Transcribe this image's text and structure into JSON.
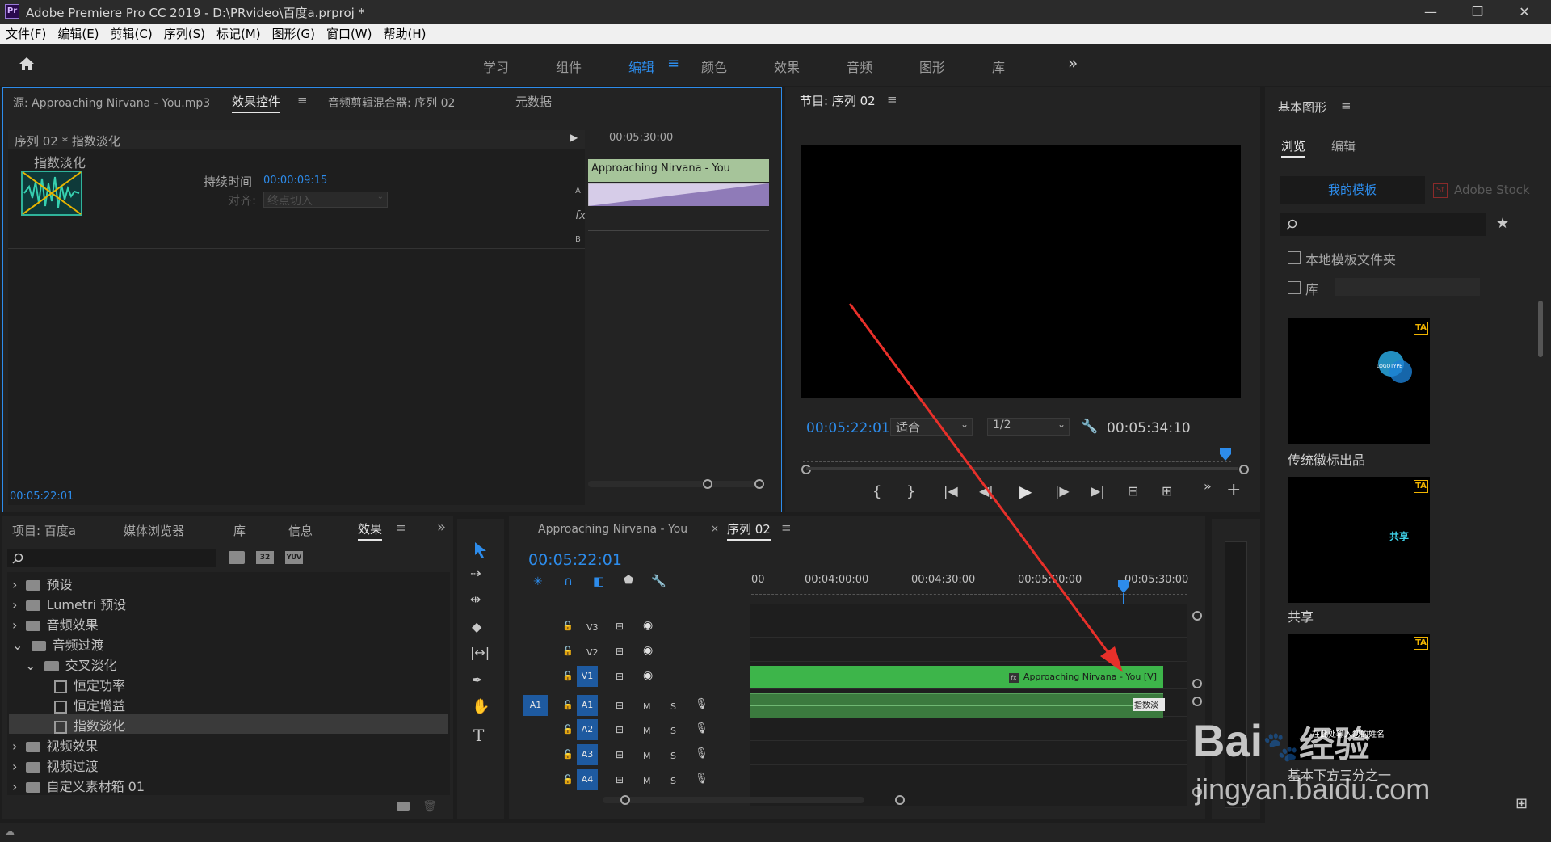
{
  "titlebar": {
    "logo": "Pr",
    "title": "Adobe Premiere Pro CC 2019 - D:\\PRvideo\\百度a.prproj *",
    "minimize": "—",
    "maximize": "❐",
    "close": "✕"
  },
  "menu": [
    "文件(F)",
    "编辑(E)",
    "剪辑(C)",
    "序列(S)",
    "标记(M)",
    "图形(G)",
    "窗口(W)",
    "帮助(H)"
  ],
  "workspaces": {
    "items": [
      "学习",
      "组件",
      "编辑",
      "颜色",
      "效果",
      "音频",
      "图形",
      "库"
    ],
    "active": "编辑",
    "more": "»"
  },
  "source_panel": {
    "tabs": [
      "源: Approaching Nirvana - You.mp3",
      "效果控件",
      "音频剪辑混合器: 序列 02",
      "元数据"
    ],
    "active_tab": "效果控件",
    "header": "序列 02 * 指数淡化",
    "effect_name": "指数淡化",
    "duration_label": "持续时间",
    "duration_value": "00:00:09:15",
    "align_label": "对齐:",
    "align_value": "终点切入",
    "timeline_time": "00:05:30:00",
    "clip_label": "Approaching Nirvana - You",
    "label_a": "A",
    "label_b": "B",
    "fx_label": "fx",
    "current_time": "00:05:22:01"
  },
  "program_monitor": {
    "title": "节目: 序列 02",
    "current_time": "00:05:22:01",
    "fit": "适合",
    "resolution": "1/2",
    "duration": "00:05:34:10"
  },
  "essential_graphics": {
    "title": "基本图形",
    "tabs": [
      "浏览",
      "编辑"
    ],
    "active_tab": "浏览",
    "subtabs": [
      "我的模板",
      "Adobe Stock"
    ],
    "active_subtab": "我的模板",
    "search_placeholder": "",
    "checkbox_local": "本地模板文件夹",
    "checkbox_lib": "库",
    "templates": [
      {
        "name": "传统徽标出品",
        "preview_text": "LOGOTYPE",
        "badge": "TA"
      },
      {
        "name": "共享",
        "preview_text": "共享",
        "badge": "TA"
      },
      {
        "name": "基本下方三分之一",
        "preview_text": "在此处输入您的姓名",
        "badge": "TA"
      }
    ]
  },
  "project_panel": {
    "tabs": [
      "项目: 百度a",
      "媒体浏览器",
      "库",
      "信息",
      "效果"
    ],
    "active_tab": "效果",
    "more": "»",
    "badges": [
      "32",
      "YUV"
    ],
    "tree": [
      {
        "label": "预设",
        "type": "folder",
        "level": 0
      },
      {
        "label": "Lumetri 预设",
        "type": "folder",
        "level": 0
      },
      {
        "label": "音频效果",
        "type": "folder",
        "level": 0
      },
      {
        "label": "音频过渡",
        "type": "folder",
        "level": 0,
        "expanded": true
      },
      {
        "label": "交叉淡化",
        "type": "folder",
        "level": 1,
        "expanded": true
      },
      {
        "label": "恒定功率",
        "type": "fx",
        "level": 2
      },
      {
        "label": "恒定增益",
        "type": "fx",
        "level": 2
      },
      {
        "label": "指数淡化",
        "type": "fx",
        "level": 2,
        "selected": true
      },
      {
        "label": "视频效果",
        "type": "folder",
        "level": 0
      },
      {
        "label": "视频过渡",
        "type": "folder",
        "level": 0
      },
      {
        "label": "自定义素材箱 01",
        "type": "folder",
        "level": 0
      }
    ]
  },
  "tools": [
    "selection",
    "track-select",
    "ripple-edit",
    "razor",
    "slip",
    "pen",
    "hand",
    "type"
  ],
  "timeline": {
    "tabs": [
      "Approaching Nirvana - You",
      "序列 02"
    ],
    "active_tab": "序列 02",
    "close": "×",
    "current_time": "00:05:22:01",
    "ruler": [
      "00",
      "00:04:00:00",
      "00:04:30:00",
      "00:05:00:00",
      "00:05:30:00"
    ],
    "tracks": [
      {
        "name": "V3",
        "type": "video"
      },
      {
        "name": "V2",
        "type": "video"
      },
      {
        "name": "V1",
        "type": "video",
        "target": true
      },
      {
        "name": "A1",
        "type": "audio",
        "source": "A1",
        "target": true
      },
      {
        "name": "A2",
        "type": "audio"
      },
      {
        "name": "A3",
        "type": "audio"
      },
      {
        "name": "A4",
        "type": "audio"
      }
    ],
    "video_clip": "Approaching Nirvana - You [V]",
    "audio_transition": "指数淡",
    "track_m": "M",
    "track_s": "S"
  },
  "colors": {
    "accent": "#2d8ceb",
    "clip_green": "#3db54a",
    "audio_clip": "#3b7a3e",
    "arrow": "#e8302a",
    "badge": "#f0b400"
  },
  "watermark": {
    "logo": "Bai",
    "logo2": "经验",
    "url": "jingyan.baidu.com"
  }
}
